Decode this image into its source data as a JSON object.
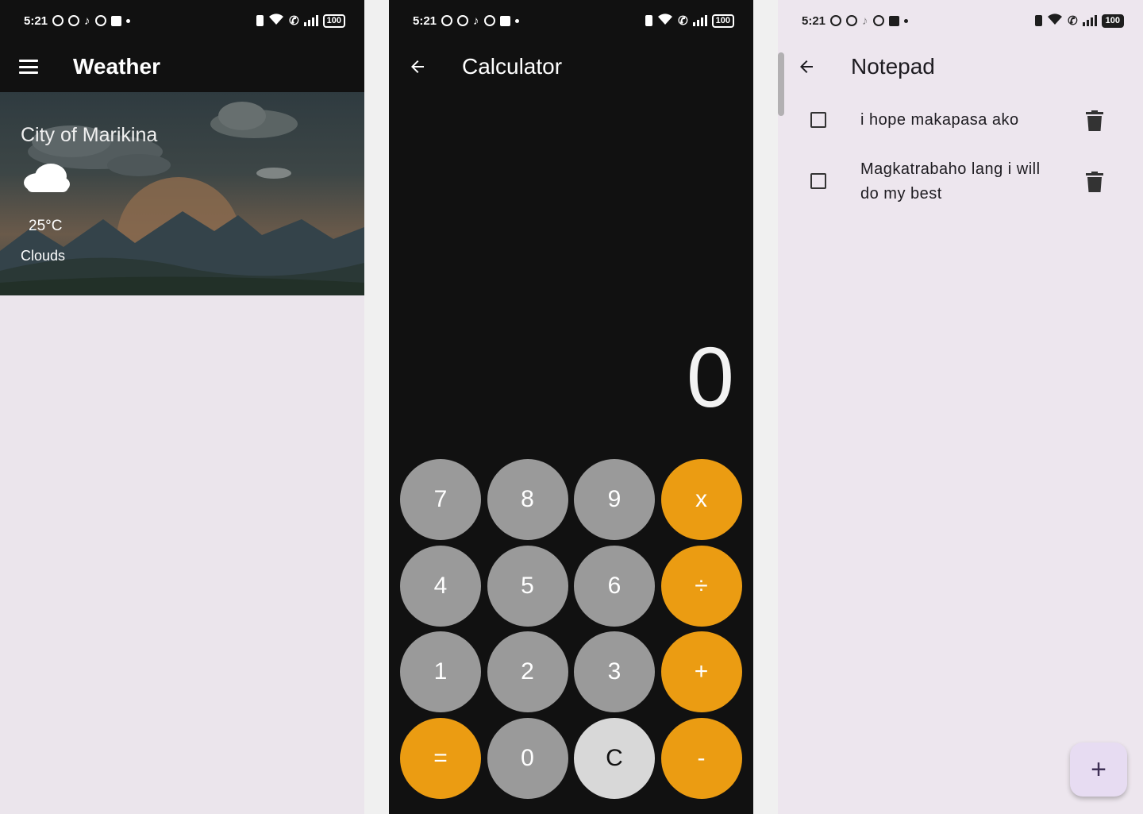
{
  "status_bar": {
    "time": "5:21",
    "battery": "100"
  },
  "weather": {
    "title": "Weather",
    "city": "City of Marikina",
    "temperature": "25°C",
    "condition": "Clouds"
  },
  "calculator": {
    "title": "Calculator",
    "display": "0",
    "keys": [
      "7",
      "8",
      "9",
      "x",
      "4",
      "5",
      "6",
      "÷",
      "1",
      "2",
      "3",
      "+",
      "=",
      "0",
      "C",
      "-"
    ]
  },
  "notepad": {
    "title": "Notepad",
    "notes": [
      {
        "text": "i hope makapasa ako",
        "checked": false
      },
      {
        "text": "Magkatrabaho lang i will do my best",
        "checked": false
      }
    ],
    "fab_label": "+"
  },
  "colors": {
    "calc_number_key": "#9a9a9a",
    "calc_operator_key": "#eb9c12",
    "calc_clear_key": "#d8d8d8",
    "app_background_light": "#ede6ee",
    "fab_background": "#e7dcf2"
  }
}
